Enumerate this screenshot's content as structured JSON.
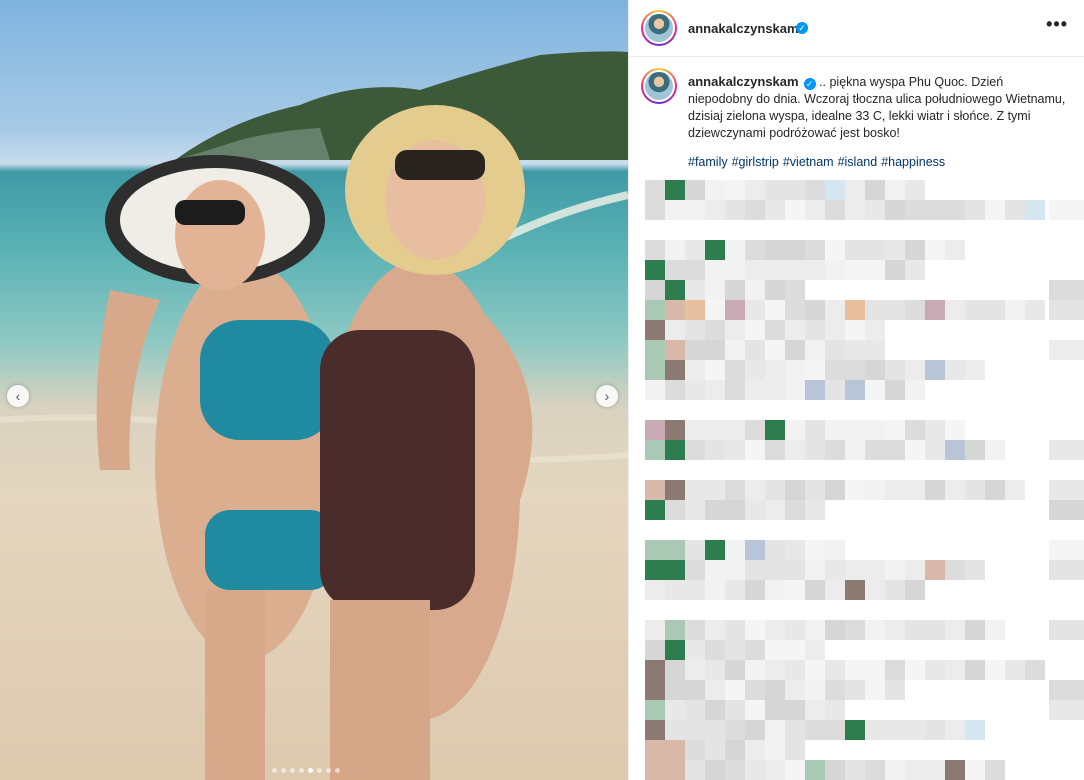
{
  "post": {
    "username": "annakalczynskam",
    "verified": true,
    "caption": ".. piękna wyspa Phu Quoc. Dzień niepodobny do dnia. Wczoraj tłoczna ulica południowego Wietnamu, dzisiaj zielona wyspa, idealne 33 C, lekki wiatr i słońce. Z tymi dziewczynami podróżować jest bosko!",
    "hashtags": [
      "#family",
      "#girlstrip",
      "#vietnam",
      "#island",
      "#happiness"
    ]
  },
  "carousel": {
    "slide_count": 8,
    "active_index": 4,
    "prev_icon": "chevron-left-icon",
    "next_icon": "chevron-right-icon"
  },
  "icons": {
    "verified": "verified-badge-icon",
    "more": "more-options-icon"
  },
  "colors": {
    "link": "#00376b",
    "verified": "#0095f6"
  }
}
